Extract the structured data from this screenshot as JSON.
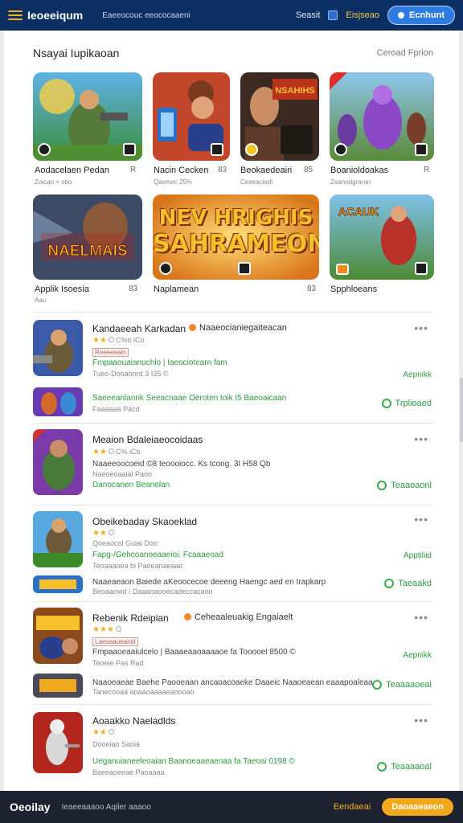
{
  "header": {
    "logo_text": "Ieoeeiqum",
    "nav_text": "Eaeeocouc eeococaaeni",
    "search_label": "Seasit",
    "region_label": "Eisjseao",
    "signin_label": "Ecnhunt"
  },
  "featured": {
    "title": "Nsayai Iupikaoan",
    "see_all": "Ceroad Fprion",
    "tiles": [
      {
        "title": "Aodacelaen Pedan",
        "sub": "Zoicari × obo",
        "num": "R"
      },
      {
        "title": "Nacin Cecken",
        "sub": "Qavmoc 25%",
        "num": "83"
      },
      {
        "title": "Beokaedeairi",
        "sub": "Ceeeaciedl",
        "num": "85"
      },
      {
        "title": "Boanioldoakas",
        "sub": "Zeanodgraran",
        "num": "R"
      },
      {
        "title": "Applik Isoesia",
        "sub": "Aau",
        "num": "83"
      },
      {
        "title": "Naplamean",
        "sub": "",
        "num": "83"
      },
      {
        "title": "Spphloeans",
        "sub": "",
        "num": ""
      }
    ],
    "banner_line1": "NEV HRIGHIS",
    "banner_line2": "SAHRAMEON",
    "tile4_art": "NAELMAIS",
    "tile2_art": "NSAHIHS",
    "tile6_art": "ACAUK"
  },
  "apps": [
    {
      "name": "Kandaeeah Karkadan",
      "tag": "Naaeocianiegaiteacan",
      "rating_note": "C%o iCo",
      "chip": "Reeeeeain",
      "green_line": "Fmpaaouaianuchlo | Iaeociotearn fam",
      "meta_line": "Tueo-Dooaonrd 3 I35 ©",
      "cta": "Aepnikk",
      "sub_green": "Saeeeanlanrik Seeacnaae Oeroten toik I5 Baeoaicaan",
      "sub_meta": "Faaaaaa Pacd",
      "sub_cta": "Trplioaed"
    },
    {
      "name": "Meaion Bdaleiaeocoidaas",
      "tag": "",
      "rating_note": "C% iCo",
      "chip": "",
      "dark_line": "Naaeeoocoeid ©8 teoooiocc. Ks tcong. 3I H58 Qb",
      "dark_line2": "Naeoeoaaial Paoo",
      "green_line": "Danocanen Beanolan",
      "cta": "Teaaoaonl"
    },
    {
      "name": "Obeikebaday Skaoeklad",
      "tag": "",
      "rating_note": "Qoeaocol Guiai Doo",
      "green_line": "Fapg-/Gehcoanoeaaeioi. Fcaaaeoad",
      "meta_line": "Teoaaaoea bi Paoeanaeaao",
      "cta": "Apptiliid",
      "sub_dark": "Naaeaeaon Baiede aKeoocecoe deeeng Haengc aed en Irapkarp",
      "sub_meta": "Beoaaowd / Daaaoaooecadeccacaon",
      "sub_cta": "Taeaakd"
    },
    {
      "name": "Rebenik Rdeipian",
      "tag": "Ceheaaleuakig Engaiaelt",
      "rating_note": "C% iCo",
      "chip": "Laeoaaueaind",
      "green_line": "Fmpaaoeaaiulcelo | Baaaeaaoaaaaoe fa Tooooei 8500 ©",
      "meta_line": "Teoeie Pas Rad",
      "cta": "Aepnikk",
      "sub_dark": "Naaoeaeae Baehe Paooeaan ancaoacoaeke Daaeic Naaoeaean eaaapoaleaa",
      "sub_meta": "Tanecooaa aoaaoaaaaeaoooao",
      "sub_cta": "Teaaaaoeal"
    },
    {
      "name": "Aoaakko Naeladlds",
      "tag": "",
      "rating_note": "Dooeiao Saoia",
      "chip": "",
      "green_line": "Ueganuianeeleoaian Baanoeaaeaenaa fa Taeoai 0198 ©",
      "meta_line": "Baeeaoeeae Paoaaaa",
      "cta": "Teaaaaoal"
    }
  ],
  "footer": {
    "logo": "Oeoilay",
    "text": "Ieaeeaaaoo Aqiler aaaoo",
    "link": "Eendaeai",
    "button": "Daoaaeaeon"
  }
}
